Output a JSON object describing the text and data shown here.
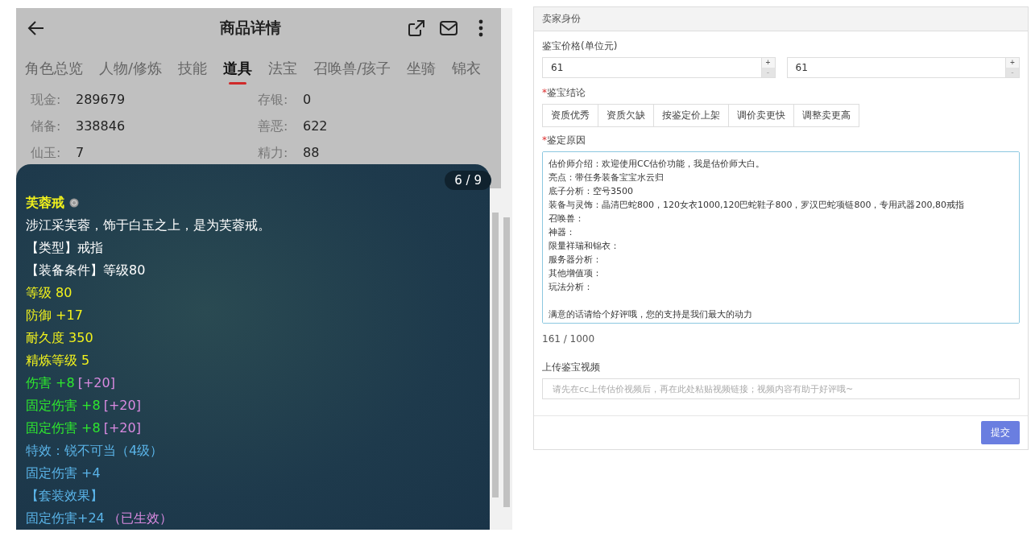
{
  "left": {
    "title": "商品详情",
    "tabs": [
      {
        "label": "角色总览",
        "selected": false
      },
      {
        "label": "人物/修炼",
        "selected": false
      },
      {
        "label": "技能",
        "selected": false
      },
      {
        "label": "道具",
        "selected": true
      },
      {
        "label": "法宝",
        "selected": false
      },
      {
        "label": "召唤兽/孩子",
        "selected": false
      },
      {
        "label": "坐骑",
        "selected": false
      },
      {
        "label": "锦衣",
        "selected": false
      }
    ],
    "stats": [
      {
        "label": "现金:",
        "value": "289679"
      },
      {
        "label": "存银:",
        "value": "0"
      },
      {
        "label": "储备:",
        "value": "338846"
      },
      {
        "label": "善恶:",
        "value": "622"
      },
      {
        "label": "仙玉:",
        "value": "7"
      },
      {
        "label": "精力:",
        "value": "88"
      }
    ],
    "item": {
      "pager": "6 / 9",
      "name": "芙蓉戒",
      "lines": [
        [
          {
            "text": "涉江采芙蓉，饰于白玉之上，是为芙蓉戒。",
            "color": "#ffffff"
          }
        ],
        [
          {
            "text": "【类型】戒指",
            "color": "#ffffff"
          }
        ],
        [
          {
            "text": "【装备条件】等级80",
            "color": "#ffffff"
          }
        ],
        [
          {
            "text": "等级 80",
            "color": "#f2f21c"
          }
        ],
        [
          {
            "text": "防御 +17",
            "color": "#f2f21c"
          }
        ],
        [
          {
            "text": "耐久度 350",
            "color": "#f2f21c"
          }
        ],
        [
          {
            "text": "精炼等级 5",
            "color": "#f2f21c"
          }
        ],
        [
          {
            "text": "伤害 +8",
            "color": "#2ee82e"
          },
          {
            "text": "[+20]",
            "color": "#d98ae0"
          }
        ],
        [
          {
            "text": "固定伤害 +8",
            "color": "#2ee82e"
          },
          {
            "text": "[+20]",
            "color": "#d98ae0"
          }
        ],
        [
          {
            "text": "固定伤害 +8",
            "color": "#2ee82e"
          },
          {
            "text": "[+20]",
            "color": "#d98ae0"
          }
        ],
        [
          {
            "text": "特效：锐不可当（4级）",
            "color": "#5ab4e8"
          }
        ],
        [
          {
            "text": "固定伤害 +4",
            "color": "#5ab4e8"
          }
        ],
        [
          {
            "text": "【套装效果】",
            "color": "#5ab4e8"
          }
        ],
        [
          {
            "text": "固定伤害+24",
            "color": "#5ab4e8"
          },
          {
            "text": "（已生效）",
            "color": "#d98ae0"
          }
        ]
      ]
    }
  },
  "form": {
    "header": "卖家身份",
    "price_label": "鉴宝价格(单位元)",
    "prices": [
      {
        "value": "61",
        "plus": "+",
        "minus": "-"
      },
      {
        "value": "61",
        "plus": "+",
        "minus": "-"
      }
    ],
    "conclusion_label": "鉴宝结论",
    "required_mark": "*",
    "conclusions": [
      {
        "label": "资质优秀",
        "selected": false
      },
      {
        "label": "资质欠缺",
        "selected": false
      },
      {
        "label": "按鉴定价上架",
        "selected": false
      },
      {
        "label": "调价卖更快",
        "selected": false
      },
      {
        "label": "调整卖更高",
        "selected": false
      }
    ],
    "reason_label": "鉴定原因",
    "reason_paragraphs": [
      [
        "估价师介绍：欢迎使用CC估价功能，我是估价师大白。",
        "亮点：带任务装备宝宝水云归",
        "底子分析：空号3500",
        "装备与灵饰：晶清巴蛇800，120女衣1000,120巴蛇鞋子800，罗汉巴蛇项链800，专用武器200,80戒指",
        "召唤兽：",
        "神器：",
        "限量祥瑞和锦衣：",
        "服务器分析：",
        "其他增值项：",
        "玩法分析："
      ],
      [
        "满意的话请给个好评哦，您的支持是我们最大的动力"
      ]
    ],
    "counter": "161 / 1000",
    "video_label": "上传鉴宝视频",
    "video_placeholder": "请先在cc上传估价视频后，再在此处粘贴视频链接；视频内容有助于好评哦~",
    "submit": "提交"
  }
}
